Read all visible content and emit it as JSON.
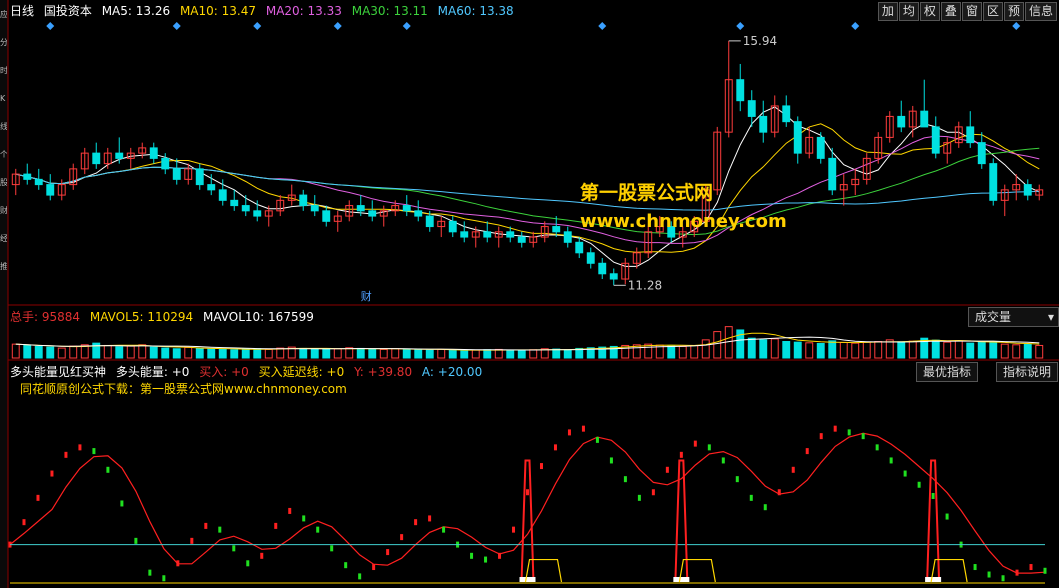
{
  "toolbar": {
    "buttons": [
      "加",
      "均",
      "权",
      "叠",
      "窗",
      "区",
      "预",
      "信息"
    ]
  },
  "left_tabs": [
    "应",
    "分",
    "时",
    "K",
    "线",
    "个",
    "股",
    "财",
    "经",
    "推"
  ],
  "main_header": {
    "period": "日线",
    "stock": "国投资本",
    "ma5_label": "MA5:",
    "ma5": "13.26",
    "ma10_label": "MA10:",
    "ma10": "13.47",
    "ma20_label": "MA20:",
    "ma20": "13.33",
    "ma30_label": "MA30:",
    "ma30": "13.11",
    "ma60_label": "MA60:",
    "ma60": "13.38"
  },
  "vol_header": {
    "total_label": "总手:",
    "total": "95884",
    "mavol5_label": "MAVOL5:",
    "mavol5": "110294",
    "mavol10_label": "MAVOL10:",
    "mavol10": "167599",
    "select": "成交量"
  },
  "ind_header": {
    "name": "多头能量见红买神",
    "energy_label": "多头能量:",
    "energy": "+0",
    "buy_label": "买入:",
    "buy": "+0",
    "delay_label": "买入延迟线:",
    "delay": "+0",
    "y_label": "Y:",
    "y": "+39.80",
    "a_label": "A:",
    "a": "+20.00",
    "btn_best": "最优指标",
    "btn_desc": "指标说明",
    "promo": "同花顺原创公式下载：第一股票公式网www.chnmoney.com"
  },
  "watermark": {
    "line1": "第一股票公式网",
    "line2": "www.chnmoney.com"
  },
  "chart_data": [
    {
      "type": "candlestick",
      "panel": "price",
      "high_label": "15.94",
      "low_label": "11.28",
      "event_marker": "财",
      "candles": [
        [
          13.2,
          13.5,
          13.0,
          13.4
        ],
        [
          13.4,
          13.6,
          13.2,
          13.3
        ],
        [
          13.3,
          13.5,
          13.1,
          13.2
        ],
        [
          13.2,
          13.4,
          12.9,
          13.0
        ],
        [
          13.0,
          13.3,
          12.9,
          13.2
        ],
        [
          13.2,
          13.6,
          13.1,
          13.5
        ],
        [
          13.5,
          13.9,
          13.4,
          13.8
        ],
        [
          13.8,
          14.0,
          13.5,
          13.6
        ],
        [
          13.6,
          13.9,
          13.5,
          13.8
        ],
        [
          13.8,
          14.1,
          13.6,
          13.7
        ],
        [
          13.7,
          13.9,
          13.5,
          13.8
        ],
        [
          13.8,
          14.0,
          13.7,
          13.9
        ],
        [
          13.9,
          14.0,
          13.6,
          13.7
        ],
        [
          13.7,
          13.8,
          13.4,
          13.5
        ],
        [
          13.5,
          13.7,
          13.2,
          13.3
        ],
        [
          13.3,
          13.6,
          13.2,
          13.5
        ],
        [
          13.5,
          13.6,
          13.1,
          13.2
        ],
        [
          13.2,
          13.4,
          13.0,
          13.1
        ],
        [
          13.1,
          13.3,
          12.8,
          12.9
        ],
        [
          12.9,
          13.1,
          12.7,
          12.8
        ],
        [
          12.8,
          13.0,
          12.6,
          12.7
        ],
        [
          12.7,
          12.9,
          12.5,
          12.6
        ],
        [
          12.6,
          12.8,
          12.4,
          12.7
        ],
        [
          12.7,
          13.0,
          12.6,
          12.9
        ],
        [
          12.9,
          13.2,
          12.8,
          13.0
        ],
        [
          13.0,
          13.1,
          12.7,
          12.8
        ],
        [
          12.8,
          13.0,
          12.6,
          12.7
        ],
        [
          12.7,
          12.8,
          12.4,
          12.5
        ],
        [
          12.5,
          12.7,
          12.3,
          12.6
        ],
        [
          12.6,
          12.9,
          12.5,
          12.8
        ],
        [
          12.8,
          13.0,
          12.6,
          12.7
        ],
        [
          12.7,
          12.9,
          12.5,
          12.6
        ],
        [
          12.6,
          12.8,
          12.4,
          12.7
        ],
        [
          12.7,
          12.9,
          12.6,
          12.8
        ],
        [
          12.8,
          13.0,
          12.6,
          12.7
        ],
        [
          12.7,
          12.9,
          12.5,
          12.6
        ],
        [
          12.6,
          12.7,
          12.3,
          12.4
        ],
        [
          12.4,
          12.6,
          12.2,
          12.5
        ],
        [
          12.5,
          12.6,
          12.2,
          12.3
        ],
        [
          12.3,
          12.5,
          12.1,
          12.2
        ],
        [
          12.2,
          12.4,
          12.0,
          12.3
        ],
        [
          12.3,
          12.5,
          12.1,
          12.2
        ],
        [
          12.2,
          12.4,
          12.0,
          12.3
        ],
        [
          12.3,
          12.4,
          12.1,
          12.2
        ],
        [
          12.2,
          12.3,
          12.0,
          12.1
        ],
        [
          12.1,
          12.3,
          12.0,
          12.2
        ],
        [
          12.2,
          12.5,
          12.1,
          12.4
        ],
        [
          12.4,
          12.6,
          12.2,
          12.3
        ],
        [
          12.3,
          12.4,
          12.0,
          12.1
        ],
        [
          12.1,
          12.2,
          11.8,
          11.9
        ],
        [
          11.9,
          12.0,
          11.6,
          11.7
        ],
        [
          11.7,
          11.8,
          11.4,
          11.5
        ],
        [
          11.5,
          11.6,
          11.28,
          11.4
        ],
        [
          11.4,
          11.8,
          11.3,
          11.7
        ],
        [
          11.7,
          12.0,
          11.6,
          11.9
        ],
        [
          11.9,
          12.4,
          11.8,
          12.3
        ],
        [
          12.3,
          12.6,
          12.2,
          12.4
        ],
        [
          12.4,
          12.5,
          12.1,
          12.2
        ],
        [
          12.2,
          12.4,
          12.0,
          12.3
        ],
        [
          12.3,
          12.6,
          12.2,
          12.5
        ],
        [
          12.5,
          13.2,
          12.4,
          13.1
        ],
        [
          13.1,
          14.3,
          13.0,
          14.2
        ],
        [
          14.2,
          15.94,
          14.1,
          15.2
        ],
        [
          15.2,
          15.5,
          14.6,
          14.8
        ],
        [
          14.8,
          15.0,
          14.3,
          14.5
        ],
        [
          14.5,
          14.8,
          14.0,
          14.2
        ],
        [
          14.2,
          14.9,
          14.1,
          14.7
        ],
        [
          14.7,
          14.9,
          14.3,
          14.4
        ],
        [
          14.4,
          14.5,
          13.6,
          13.8
        ],
        [
          13.8,
          14.3,
          13.7,
          14.1
        ],
        [
          14.1,
          14.2,
          13.6,
          13.7
        ],
        [
          13.7,
          13.9,
          13.0,
          13.1
        ],
        [
          13.1,
          13.4,
          12.8,
          13.2
        ],
        [
          13.2,
          13.5,
          13.0,
          13.3
        ],
        [
          13.3,
          13.8,
          13.2,
          13.7
        ],
        [
          13.7,
          14.2,
          13.6,
          14.1
        ],
        [
          14.1,
          14.6,
          14.0,
          14.5
        ],
        [
          14.5,
          14.8,
          14.2,
          14.3
        ],
        [
          14.3,
          14.7,
          14.1,
          14.6
        ],
        [
          14.6,
          15.2,
          14.4,
          14.3
        ],
        [
          14.3,
          14.5,
          13.7,
          13.8
        ],
        [
          13.8,
          14.1,
          13.6,
          14.0
        ],
        [
          14.0,
          14.4,
          13.9,
          14.3
        ],
        [
          14.3,
          14.6,
          13.9,
          14.0
        ],
        [
          14.0,
          14.2,
          13.5,
          13.6
        ],
        [
          13.6,
          13.7,
          12.8,
          12.9
        ],
        [
          12.9,
          13.2,
          12.6,
          13.1
        ],
        [
          13.1,
          13.4,
          12.9,
          13.2
        ],
        [
          13.2,
          13.3,
          12.9,
          13.0
        ],
        [
          13.0,
          13.2,
          12.9,
          13.1
        ]
      ]
    },
    {
      "type": "bar",
      "panel": "volume",
      "values": [
        42,
        38,
        35,
        33,
        30,
        36,
        40,
        45,
        38,
        34,
        36,
        40,
        33,
        30,
        28,
        32,
        29,
        27,
        26,
        25,
        27,
        28,
        26,
        30,
        33,
        29,
        27,
        26,
        28,
        31,
        29,
        27,
        26,
        28,
        27,
        25,
        24,
        26,
        23,
        22,
        24,
        25,
        26,
        24,
        23,
        25,
        28,
        27,
        25,
        29,
        31,
        33,
        35,
        38,
        40,
        42,
        39,
        36,
        35,
        38,
        55,
        80,
        95,
        85,
        60,
        55,
        58,
        50,
        48,
        46,
        44,
        52,
        47,
        45,
        48,
        50,
        55,
        49,
        51,
        60,
        54,
        48,
        52,
        45,
        47,
        50,
        42,
        40,
        41,
        38
      ]
    },
    {
      "type": "line",
      "panel": "indicator",
      "series": [
        {
          "name": "多头能量",
          "values": [
            20,
            32,
            45,
            58,
            68,
            72,
            70,
            60,
            42,
            22,
            5,
            2,
            10,
            22,
            30,
            28,
            18,
            10,
            14,
            30,
            38,
            34,
            28,
            18,
            9,
            3,
            8,
            16,
            24,
            32,
            34,
            28,
            20,
            14,
            12,
            14,
            28,
            48,
            62,
            72,
            80,
            82,
            76,
            65,
            55,
            45,
            48,
            60,
            68,
            74,
            72,
            65,
            55,
            45,
            40,
            48,
            60,
            70,
            78,
            82,
            80,
            78,
            72,
            65,
            58,
            52,
            46,
            35,
            20,
            8,
            4,
            2,
            5,
            8,
            6
          ]
        }
      ]
    }
  ]
}
